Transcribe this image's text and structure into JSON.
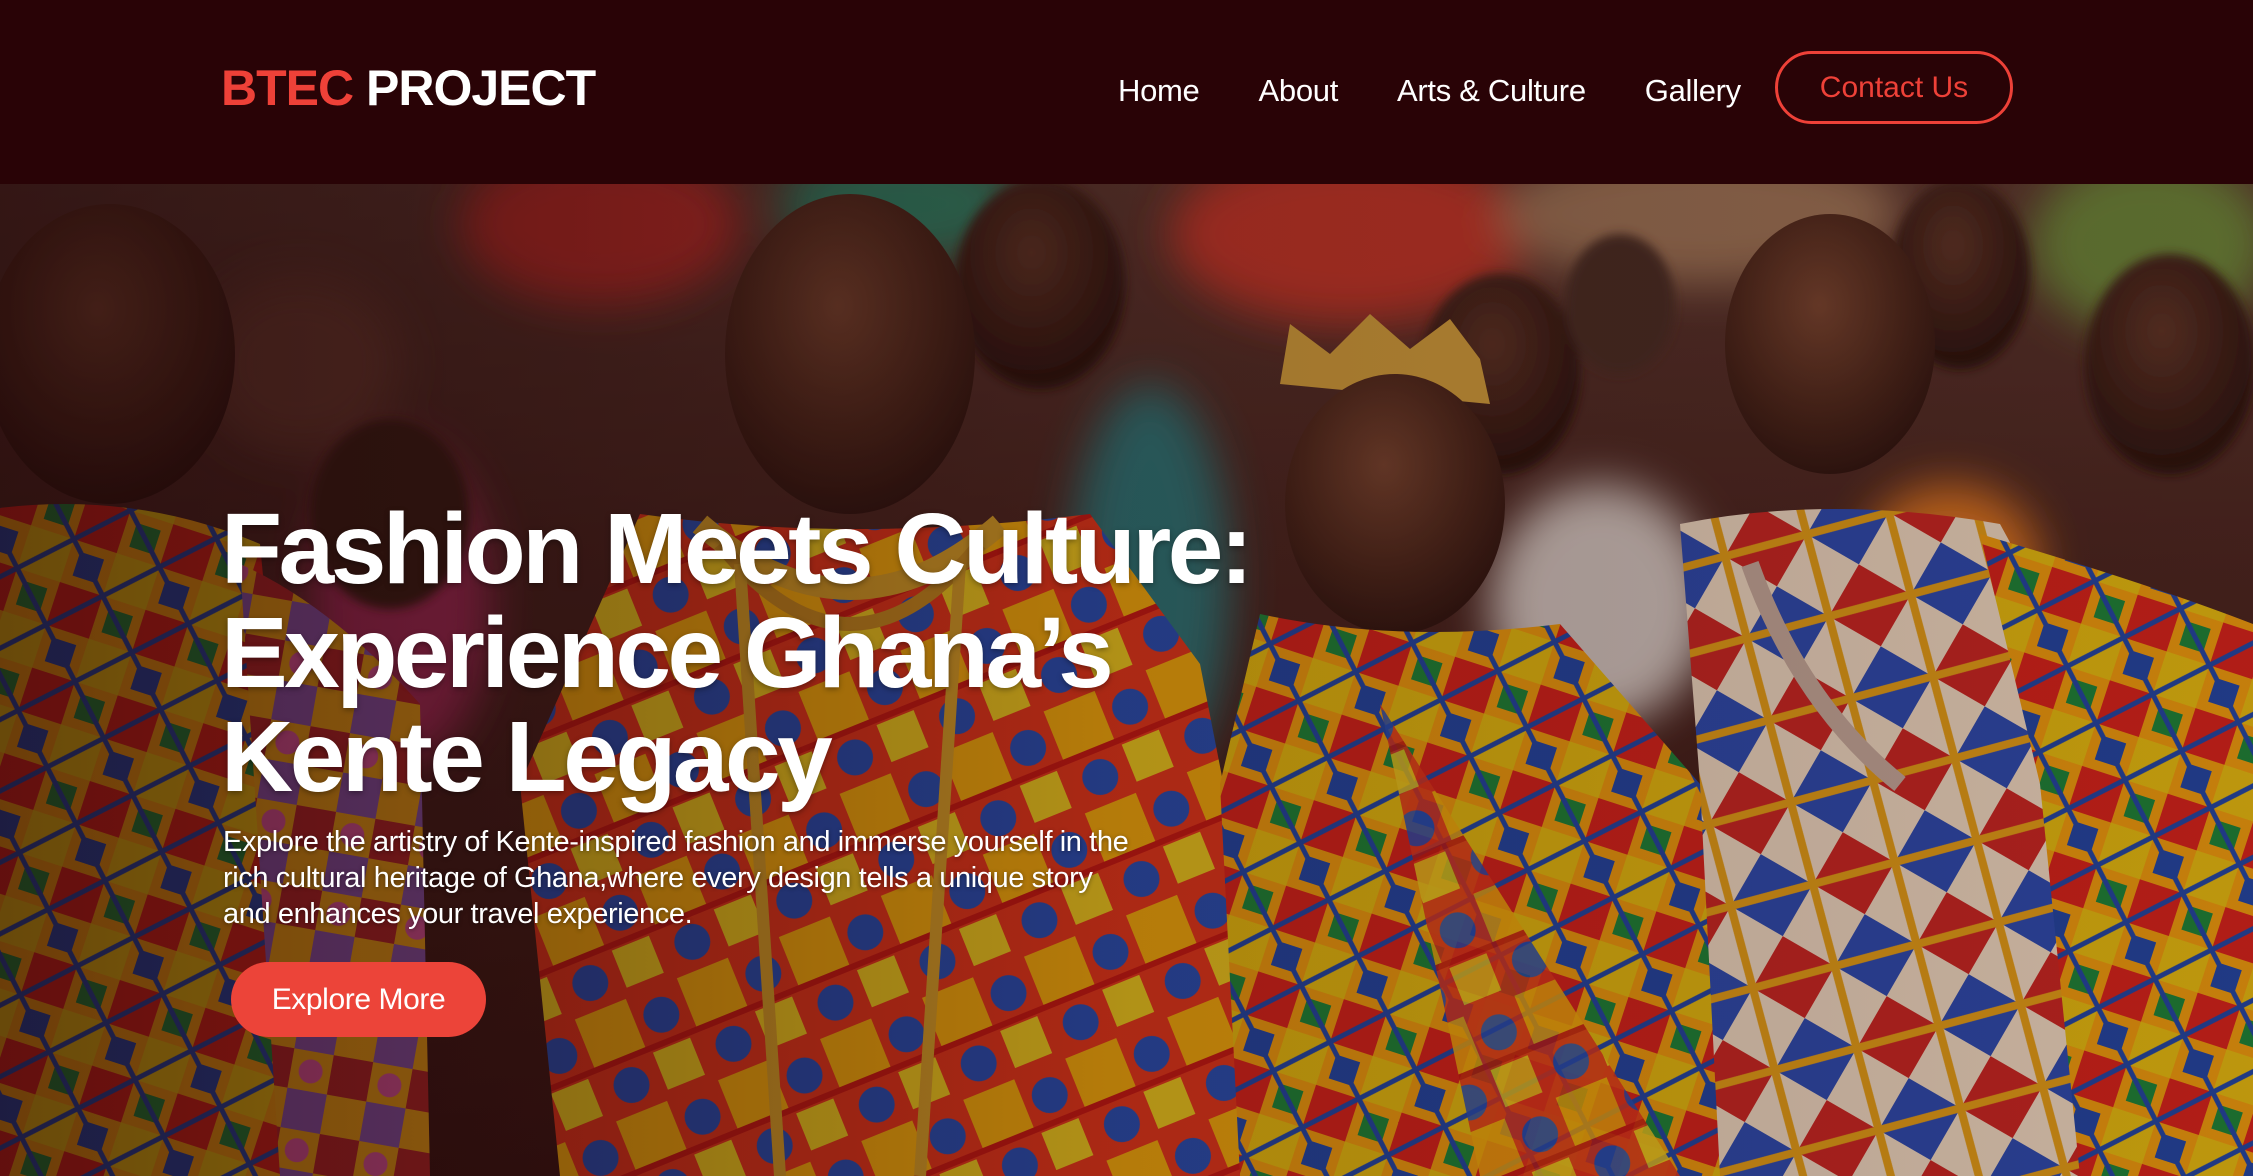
{
  "brand": {
    "accent": "BTEC",
    "rest": "PROJECT",
    "accent_color": "#ee4138"
  },
  "nav": {
    "items": [
      "Home",
      "About",
      "Arts & Culture",
      "Gallery"
    ],
    "contact_label": "Contact Us"
  },
  "hero": {
    "title_lines": [
      "Fashion Meets Culture:",
      "Experience Ghana’s",
      "Kente Legacy"
    ],
    "subtitle_lines": [
      "Explore the artistry of Kente-inspired fashion and immerse yourself in the",
      "rich cultural heritage of Ghana,where every design tells a unique story",
      "and enhances your travel experience."
    ],
    "cta_label": "Explore More",
    "background_image": "photo of people in colorful kente cloth at a cultural festival",
    "cta_color": "#ec4439"
  },
  "colors": {
    "header_bg": "#290306",
    "text": "#ffffff"
  }
}
